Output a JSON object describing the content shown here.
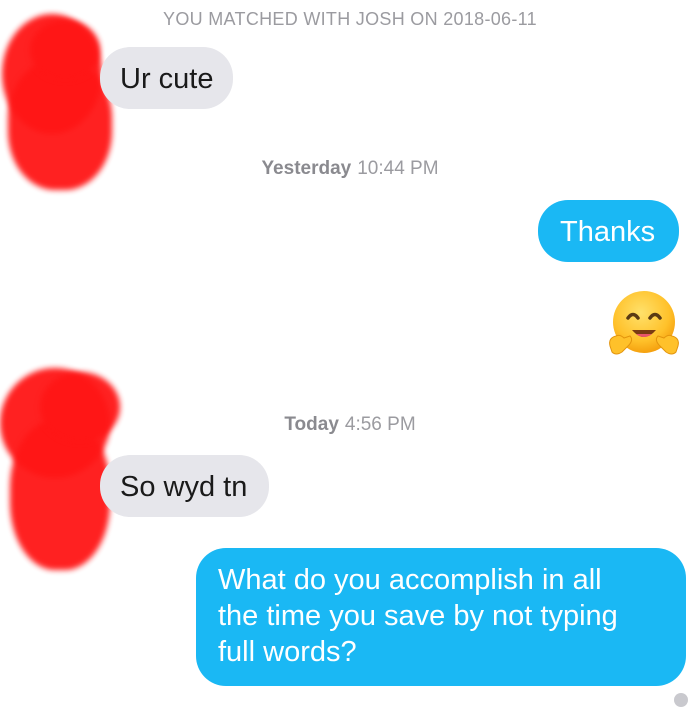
{
  "match_banner": "YOU MATCHED WITH JOSH ON 2018-06-11",
  "messages": [
    {
      "direction": "incoming",
      "text": "Ur cute"
    },
    {
      "direction": "outgoing",
      "text": "Thanks"
    },
    {
      "direction": "outgoing",
      "type": "emoji",
      "emoji": "hugging-face"
    },
    {
      "direction": "incoming",
      "text": "So wyd tn"
    },
    {
      "direction": "outgoing",
      "lines": [
        "What do you accomplish in all",
        "the time you save by not typing",
        "full words?"
      ]
    }
  ],
  "timestamps": [
    {
      "day": "Yesterday",
      "time": "10:44 PM"
    },
    {
      "day": "Today",
      "time": "4:56 PM"
    }
  ],
  "colors": {
    "outgoing_bubble": "#1ab8f4",
    "incoming_bubble": "#e6e6eb",
    "timestamp_text": "#9b9ba0",
    "redaction": "#ff1616"
  }
}
